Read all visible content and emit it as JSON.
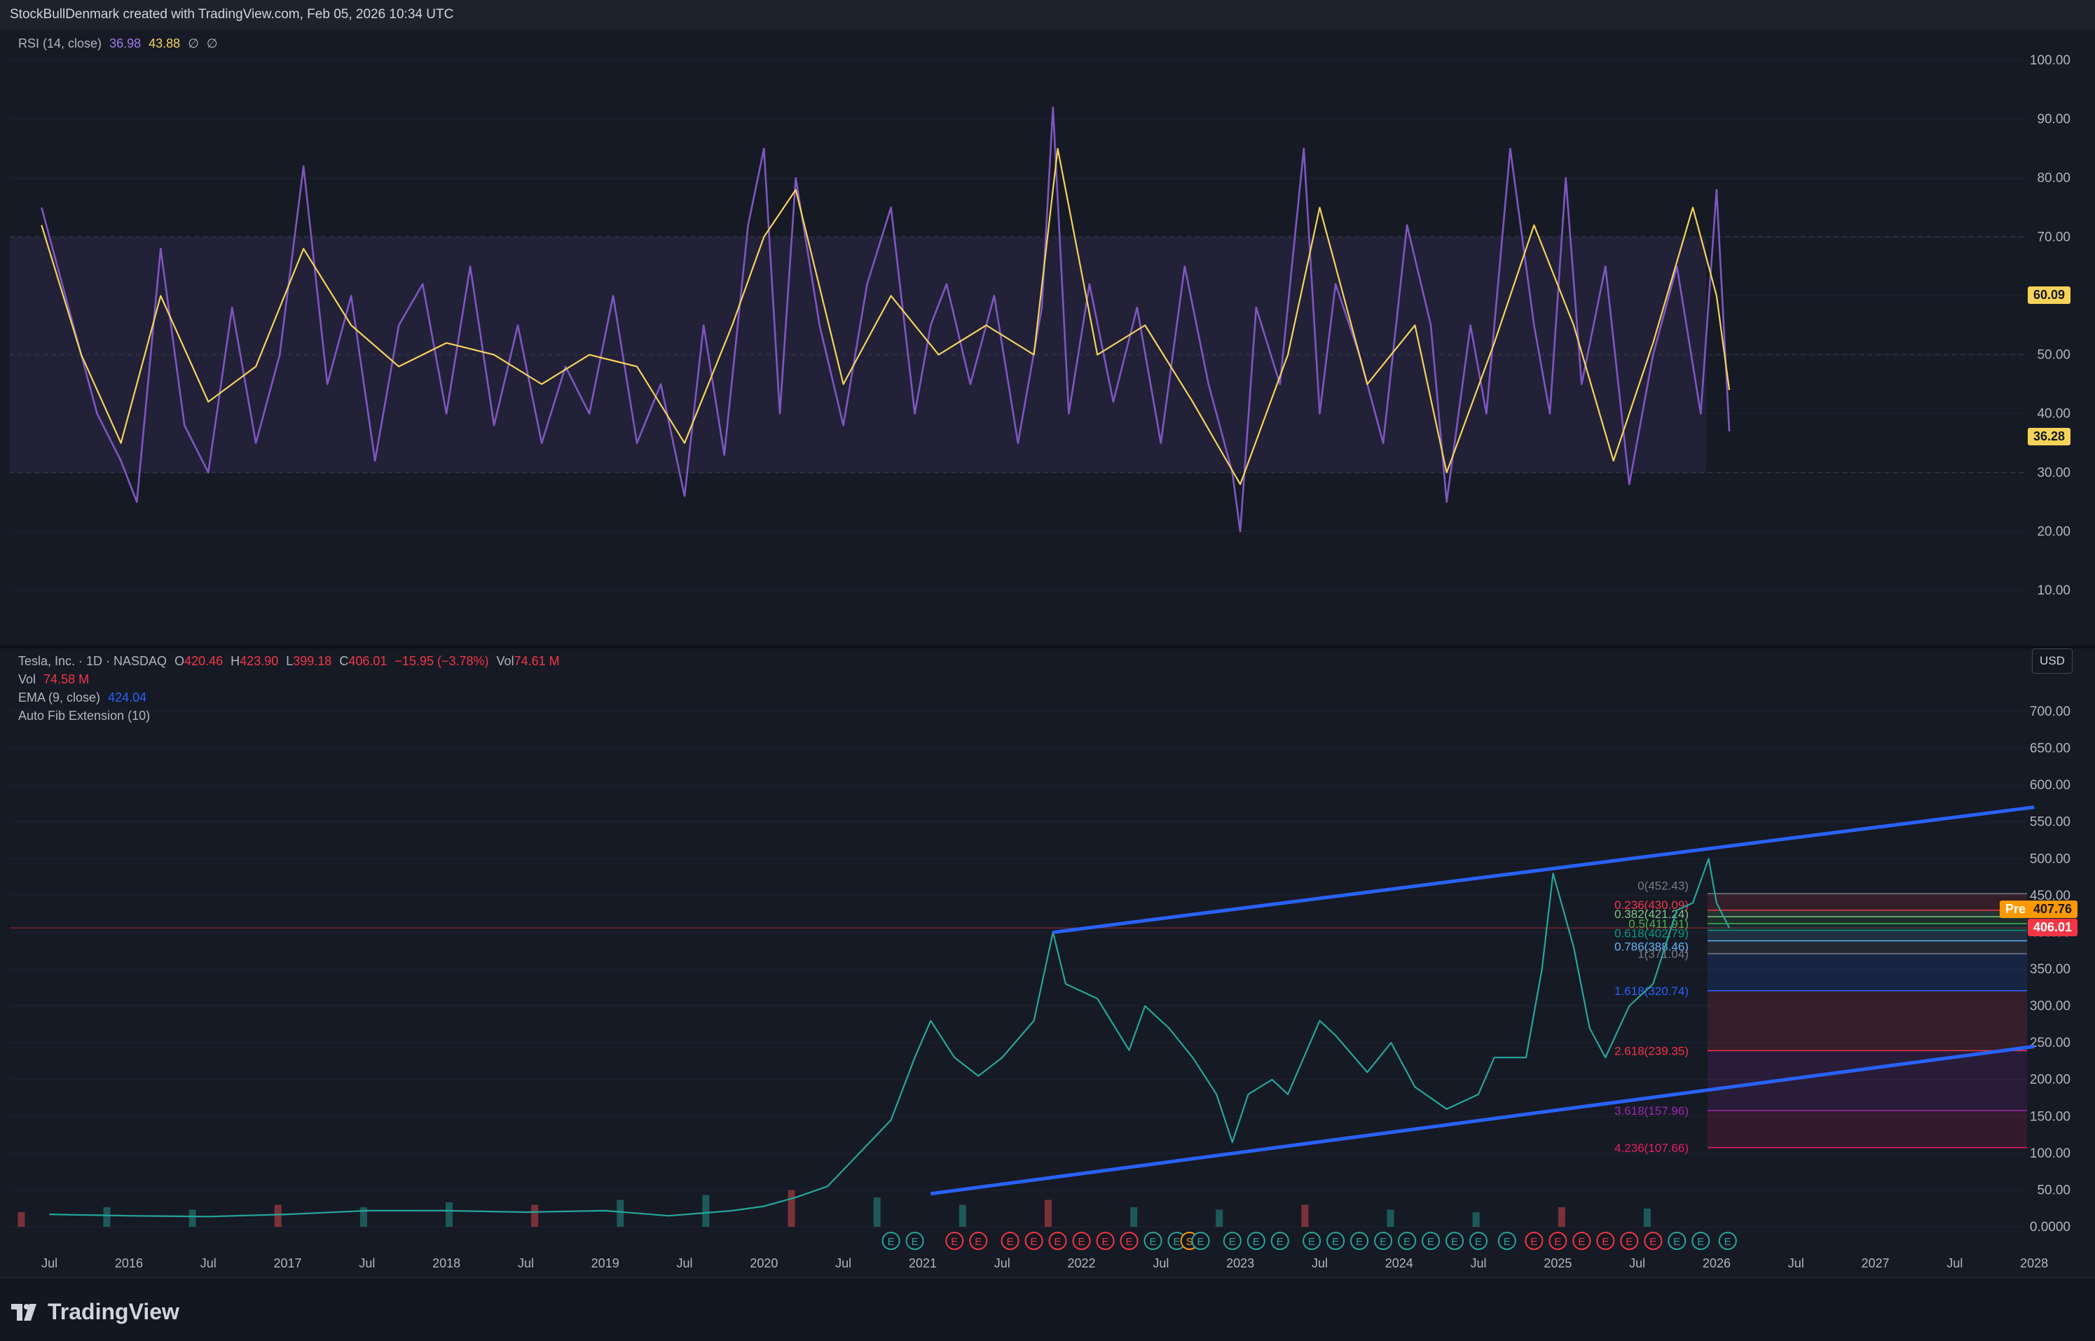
{
  "header": {
    "credit": "StockBullDenmark created with TradingView.com, Feb 05, 2026 10:34 UTC"
  },
  "rsi_legend": {
    "label": "RSI (14, close)",
    "rsi_value": "36.98",
    "ma_value": "43.88",
    "extra1": "∅",
    "extra2": "∅"
  },
  "rsi_badges": {
    "ma_last": "60.09",
    "rsi_last": "36.28"
  },
  "price_legend": {
    "symbol": "Tesla, Inc. · 1D · NASDAQ",
    "o_label": "O",
    "o_value": "420.46",
    "h_label": "H",
    "h_value": "423.90",
    "l_label": "L",
    "l_value": "399.18",
    "c_label": "C",
    "c_value": "406.01",
    "change": "−15.95 (−3.78%)",
    "vol_label": "Vol",
    "vol_value": "74.61 M",
    "vol_line_label": "Vol",
    "vol_line_value": "74.58 M",
    "ema_label": "EMA (9, close)",
    "ema_value": "424.04",
    "fib_label": "Auto Fib Extension (10)"
  },
  "price_badges": {
    "pre_label": "Pre",
    "pre_value": "407.76",
    "last_value": "406.01"
  },
  "currency": "USD",
  "colors": {
    "background": "#161a25",
    "rsi_line": "#7e57c2",
    "rsi_ma": "#f5d35b",
    "channel": "#2962ff",
    "up": "#26a69a",
    "down": "#ef5350",
    "pre_badge": "#ff9800",
    "last_badge": "#f23645"
  },
  "icons": [
    "tradingview-logo-icon",
    "earnings-marker-icon",
    "split-marker-icon"
  ],
  "footer": {
    "logo_text": "TradingView"
  },
  "chart_data": [
    {
      "type": "line",
      "title": "RSI (14, close)",
      "ylim": [
        0,
        105
      ],
      "y_ticks": [
        "100.00",
        "90.00",
        "80.00",
        "70.00",
        "60.00",
        "50.00",
        "40.00",
        "30.00",
        "20.00",
        "10.00"
      ],
      "bands": {
        "upper": 70,
        "middle": 50,
        "lower": 30
      },
      "series": [
        {
          "name": "RSI",
          "x": [
            2015.45,
            2015.62,
            2015.8,
            2015.95,
            2016.05,
            2016.2,
            2016.35,
            2016.5,
            2016.65,
            2016.8,
            2016.95,
            2017.1,
            2017.25,
            2017.4,
            2017.55,
            2017.7,
            2017.85,
            2018.0,
            2018.15,
            2018.3,
            2018.45,
            2018.6,
            2018.75,
            2018.9,
            2019.05,
            2019.2,
            2019.35,
            2019.5,
            2019.62,
            2019.75,
            2019.9,
            2020.0,
            2020.1,
            2020.2,
            2020.35,
            2020.5,
            2020.65,
            2020.8,
            2020.95,
            2021.05,
            2021.15,
            2021.3,
            2021.45,
            2021.6,
            2021.75,
            2021.82,
            2021.92,
            2022.05,
            2022.2,
            2022.35,
            2022.5,
            2022.65,
            2022.8,
            2022.95,
            2023.0,
            2023.1,
            2023.25,
            2023.4,
            2023.5,
            2023.6,
            2023.75,
            2023.9,
            2024.05,
            2024.2,
            2024.3,
            2024.45,
            2024.55,
            2024.7,
            2024.85,
            2024.95,
            2025.05,
            2025.15,
            2025.3,
            2025.45,
            2025.6,
            2025.75,
            2025.9,
            2026.0,
            2026.08
          ],
          "values": [
            75,
            58,
            40,
            32,
            25,
            68,
            38,
            30,
            58,
            35,
            50,
            82,
            45,
            60,
            32,
            55,
            62,
            40,
            65,
            38,
            55,
            35,
            48,
            40,
            60,
            35,
            45,
            26,
            55,
            33,
            72,
            85,
            40,
            80,
            55,
            38,
            62,
            75,
            40,
            55,
            62,
            45,
            60,
            35,
            58,
            92,
            40,
            62,
            42,
            58,
            35,
            65,
            45,
            30,
            20,
            58,
            45,
            85,
            40,
            62,
            50,
            35,
            72,
            55,
            25,
            55,
            40,
            85,
            55,
            40,
            80,
            45,
            65,
            28,
            50,
            65,
            40,
            78,
            37
          ]
        },
        {
          "name": "RSI-based MA",
          "x": [
            2015.45,
            2015.7,
            2015.95,
            2016.2,
            2016.5,
            2016.8,
            2017.1,
            2017.4,
            2017.7,
            2018.0,
            2018.3,
            2018.6,
            2018.9,
            2019.2,
            2019.5,
            2019.8,
            2020.0,
            2020.2,
            2020.5,
            2020.8,
            2021.1,
            2021.4,
            2021.7,
            2021.85,
            2022.1,
            2022.4,
            2022.7,
            2023.0,
            2023.3,
            2023.5,
            2023.8,
            2024.1,
            2024.3,
            2024.6,
            2024.85,
            2025.1,
            2025.35,
            2025.6,
            2025.85,
            2026.0,
            2026.08
          ],
          "values": [
            72,
            50,
            35,
            60,
            42,
            48,
            68,
            55,
            48,
            52,
            50,
            45,
            50,
            48,
            35,
            55,
            70,
            78,
            45,
            60,
            50,
            55,
            50,
            85,
            50,
            55,
            42,
            28,
            50,
            75,
            45,
            55,
            30,
            52,
            72,
            55,
            32,
            52,
            75,
            60,
            44
          ]
        }
      ]
    },
    {
      "type": "line",
      "title": "Tesla, Inc. · 1D · NASDAQ",
      "ylim": [
        -20,
        740
      ],
      "y_ticks": [
        "700.00",
        "650.00",
        "600.00",
        "550.00",
        "500.00",
        "450.00",
        "400.00",
        "350.00",
        "300.00",
        "250.00",
        "200.00",
        "150.00",
        "100.00",
        "50.00",
        "0.0000"
      ],
      "x_ticks": [
        "Jul",
        "2016",
        "Jul",
        "2017",
        "Jul",
        "2018",
        "Jul",
        "2019",
        "Jul",
        "2020",
        "Jul",
        "2021",
        "Jul",
        "2022",
        "Jul",
        "2023",
        "Jul",
        "2024",
        "Jul",
        "2025",
        "Jul",
        "2026",
        "Jul",
        "2027",
        "Jul",
        "2028"
      ],
      "series": [
        {
          "name": "Close",
          "x": [
            2015.5,
            2016.0,
            2016.5,
            2017.0,
            2017.5,
            2018.0,
            2018.5,
            2019.0,
            2019.4,
            2019.8,
            2020.0,
            2020.2,
            2020.4,
            2020.6,
            2020.8,
            2020.95,
            2021.05,
            2021.2,
            2021.35,
            2021.5,
            2021.7,
            2021.82,
            2021.9,
            2022.1,
            2022.3,
            2022.4,
            2022.55,
            2022.7,
            2022.85,
            2022.95,
            2023.05,
            2023.2,
            2023.3,
            2023.5,
            2023.6,
            2023.8,
            2023.95,
            2024.1,
            2024.3,
            2024.5,
            2024.6,
            2024.8,
            2024.9,
            2024.97,
            2025.1,
            2025.2,
            2025.3,
            2025.45,
            2025.6,
            2025.75,
            2025.85,
            2025.95,
            2026.0,
            2026.08
          ],
          "values": [
            17,
            15,
            14,
            17,
            22,
            22,
            20,
            22,
            15,
            22,
            28,
            40,
            55,
            100,
            145,
            230,
            280,
            230,
            205,
            230,
            280,
            400,
            330,
            310,
            240,
            300,
            270,
            230,
            180,
            115,
            180,
            200,
            180,
            280,
            260,
            210,
            250,
            190,
            160,
            180,
            230,
            230,
            350,
            480,
            380,
            270,
            230,
            300,
            330,
            430,
            440,
            500,
            440,
            406
          ]
        }
      ],
      "volume_m": [
        60,
        80,
        70,
        90,
        80,
        100,
        90,
        110,
        130,
        150,
        120,
        90,
        110,
        80,
        70,
        90,
        70,
        60,
        80,
        75
      ],
      "channel": {
        "upper": [
          {
            "x": 2021.82,
            "y": 400
          },
          {
            "x": 2028.0,
            "y": 570
          }
        ],
        "lower": [
          {
            "x": 2021.05,
            "y": 45
          },
          {
            "x": 2028.0,
            "y": 245
          }
        ]
      },
      "fib_levels": [
        {
          "label": "0(452.43)",
          "value": 452.43,
          "color": "#787b86"
        },
        {
          "label": "0.236(430.09)",
          "value": 430.09,
          "color": "#f23645"
        },
        {
          "label": "0.382(421.24)",
          "value": 421.24,
          "color": "#81c784"
        },
        {
          "label": "0.5(411.91)",
          "value": 411.91,
          "color": "#4caf50"
        },
        {
          "label": "0.618(402.79)",
          "value": 402.79,
          "color": "#089981"
        },
        {
          "label": "0.786(388.46)",
          "value": 388.46,
          "color": "#64b5f6"
        },
        {
          "label": "1(371.04)",
          "value": 371.04,
          "color": "#787b86"
        },
        {
          "label": "1.618(320.74)",
          "value": 320.74,
          "color": "#2962ff"
        },
        {
          "label": "2.618(239.35)",
          "value": 239.35,
          "color": "#f23645"
        },
        {
          "label": "3.618(157.96)",
          "value": 157.96,
          "color": "#9c27b0"
        },
        {
          "label": "4.236(107.66)",
          "value": 107.66,
          "color": "#e91e63"
        }
      ],
      "events": [
        {
          "x": 2020.8,
          "kind": "E"
        },
        {
          "x": 2020.95,
          "kind": "E"
        },
        {
          "x": 2021.2,
          "kind": "E"
        },
        {
          "x": 2021.35,
          "kind": "E"
        },
        {
          "x": 2021.55,
          "kind": "E"
        },
        {
          "x": 2021.7,
          "kind": "E"
        },
        {
          "x": 2021.85,
          "kind": "E"
        },
        {
          "x": 2022.0,
          "kind": "E"
        },
        {
          "x": 2022.15,
          "kind": "E"
        },
        {
          "x": 2022.3,
          "kind": "E"
        },
        {
          "x": 2022.45,
          "kind": "E"
        },
        {
          "x": 2022.6,
          "kind": "E"
        },
        {
          "x": 2022.68,
          "kind": "S"
        },
        {
          "x": 2022.75,
          "kind": "E"
        },
        {
          "x": 2022.95,
          "kind": "E"
        },
        {
          "x": 2023.1,
          "kind": "E"
        },
        {
          "x": 2023.25,
          "kind": "E"
        },
        {
          "x": 2023.45,
          "kind": "E"
        },
        {
          "x": 2023.6,
          "kind": "E"
        },
        {
          "x": 2023.75,
          "kind": "E"
        },
        {
          "x": 2023.9,
          "kind": "E"
        },
        {
          "x": 2024.05,
          "kind": "E"
        },
        {
          "x": 2024.2,
          "kind": "E"
        },
        {
          "x": 2024.35,
          "kind": "E"
        },
        {
          "x": 2024.5,
          "kind": "E"
        },
        {
          "x": 2024.68,
          "kind": "E"
        },
        {
          "x": 2024.85,
          "kind": "E"
        },
        {
          "x": 2025.0,
          "kind": "E"
        },
        {
          "x": 2025.15,
          "kind": "E"
        },
        {
          "x": 2025.3,
          "kind": "E"
        },
        {
          "x": 2025.45,
          "kind": "E"
        },
        {
          "x": 2025.6,
          "kind": "E"
        },
        {
          "x": 2025.75,
          "kind": "E"
        },
        {
          "x": 2025.9,
          "kind": "E"
        },
        {
          "x": 2026.07,
          "kind": "E"
        }
      ]
    }
  ]
}
